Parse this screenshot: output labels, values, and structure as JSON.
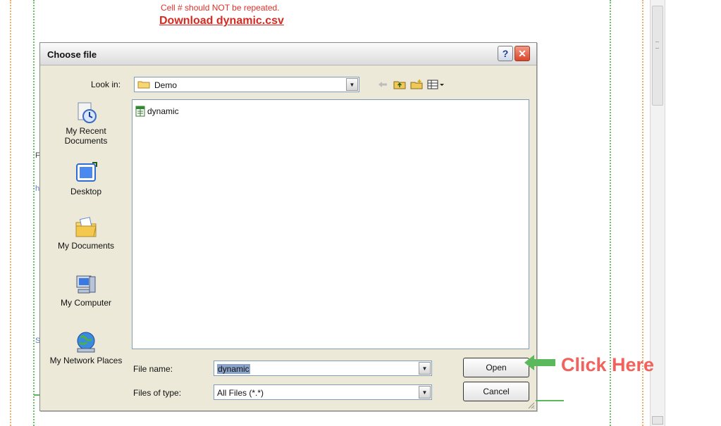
{
  "page": {
    "notice": "Cell # should NOT be repeated.",
    "download_link": "Download dynamic.csv",
    "fragments": [
      "F",
      "h",
      "S"
    ]
  },
  "dialog": {
    "title": "Choose file",
    "help_label": "?",
    "close_label": "✕",
    "look_in_label": "Look in:",
    "look_in_value": "Demo",
    "places": [
      {
        "label": "My Recent Documents",
        "icon": "recent-documents-icon"
      },
      {
        "label": "Desktop",
        "icon": "desktop-icon"
      },
      {
        "label": "My Documents",
        "icon": "my-documents-icon"
      },
      {
        "label": "My Computer",
        "icon": "my-computer-icon"
      },
      {
        "label": "My Network Places",
        "icon": "network-places-icon"
      }
    ],
    "files": [
      {
        "name": "dynamic",
        "icon": "csv-file-icon"
      }
    ],
    "file_name_label": "File name:",
    "file_name_value": "dynamic",
    "files_of_type_label": "Files of type:",
    "files_of_type_value": "All Files (*.*)",
    "open_label": "Open",
    "cancel_label": "Cancel"
  },
  "annotation": {
    "text": "Click Here",
    "color": "#f2615c",
    "arrow_color": "#5cb85c"
  }
}
